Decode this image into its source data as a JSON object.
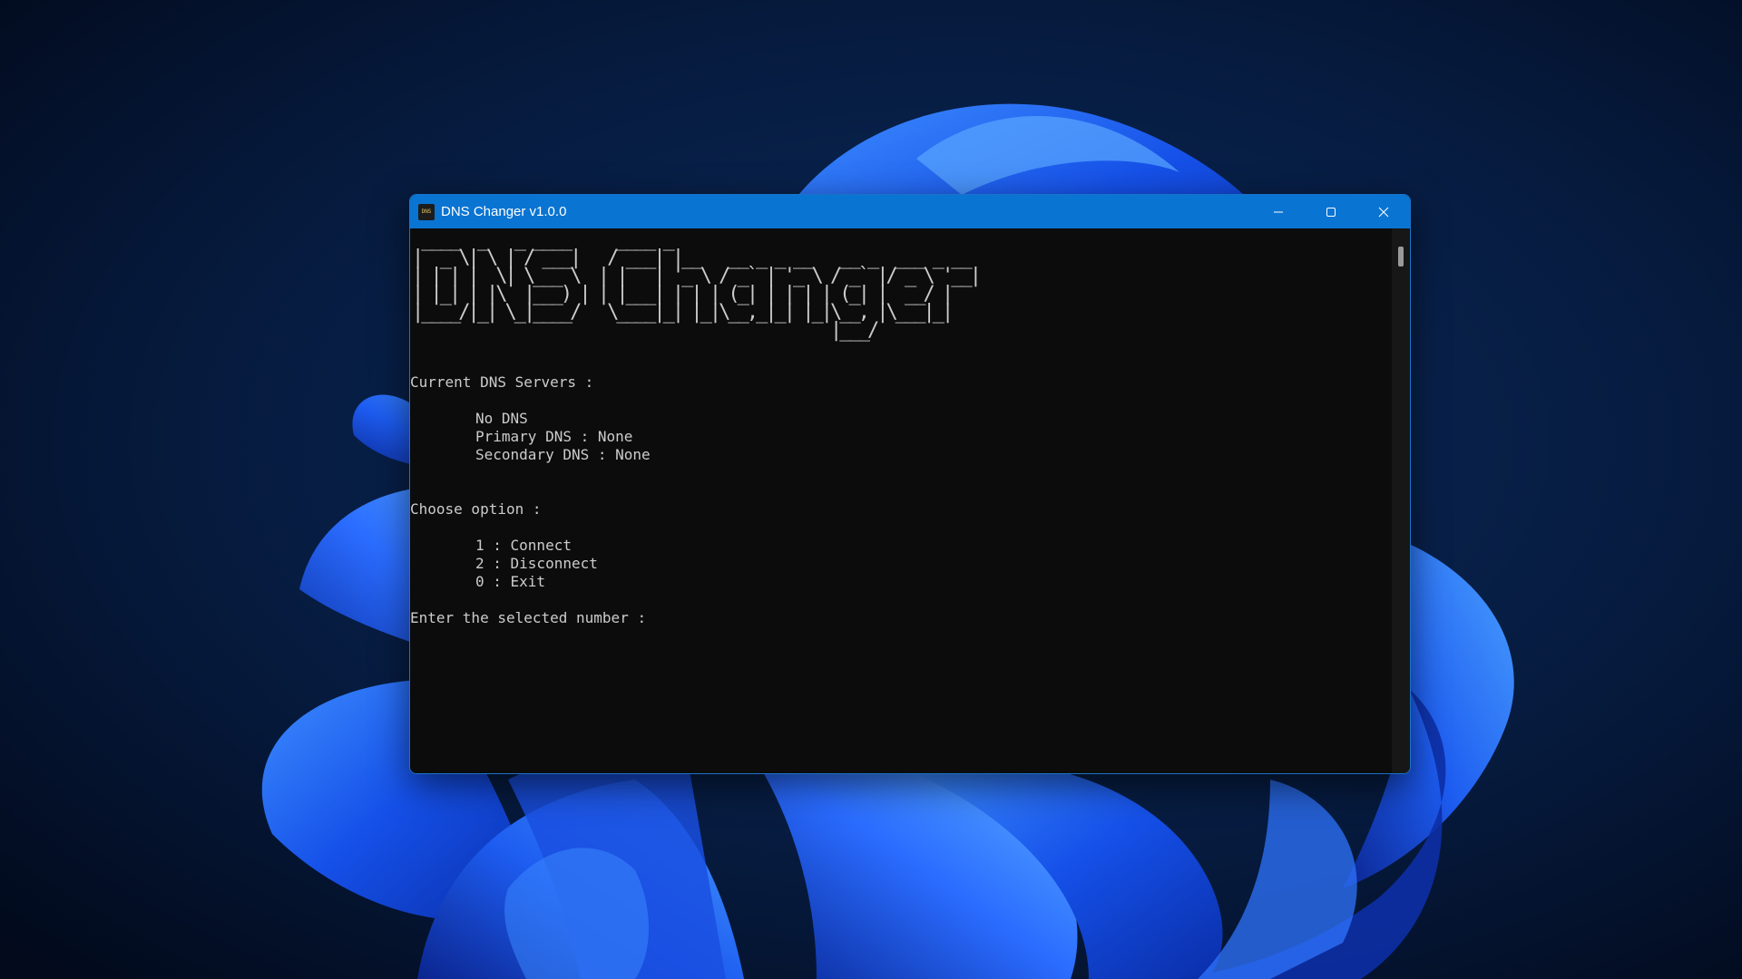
{
  "window": {
    "title": "DNS Changer v1.0.0",
    "icon_label": "DNS",
    "controls": {
      "minimize": "minimize-icon",
      "maximize": "maximize-icon",
      "close": "close-icon"
    }
  },
  "console": {
    "banner_ascii": [
      " ____  _   _ ____     ____ _                                 ",
      "|  _ \\| \\ | / ___|   / ___| |__   __ _ _ __   __ _  ___ _ __ ",
      "| | | |  \\| \\___ \\  | |   | '_ \\ / _` | '_ \\ / _` |/ _ \\ '__|",
      "| |_| | |\\  |___) | | |___| | | | (_| | | | | (_| |  __/ |   ",
      "|____/|_| \\_|____/   \\____|_| |_|\\__,_|_| |_|\\__, |\\___|_|   ",
      "                                             |___/           "
    ],
    "current_servers_heading": "Current DNS Servers :",
    "no_dns": "No DNS",
    "primary_dns": "Primary DNS : None",
    "secondary_dns": "Secondary DNS : None",
    "choose_heading": "Choose option :",
    "options": [
      "1 : Connect",
      "2 : Disconnect",
      "0 : Exit"
    ],
    "prompt": "Enter the selected number :"
  },
  "colors": {
    "titlebar": "#0a74d2",
    "console_bg": "#0c0c0c",
    "console_text": "#cccccc"
  }
}
